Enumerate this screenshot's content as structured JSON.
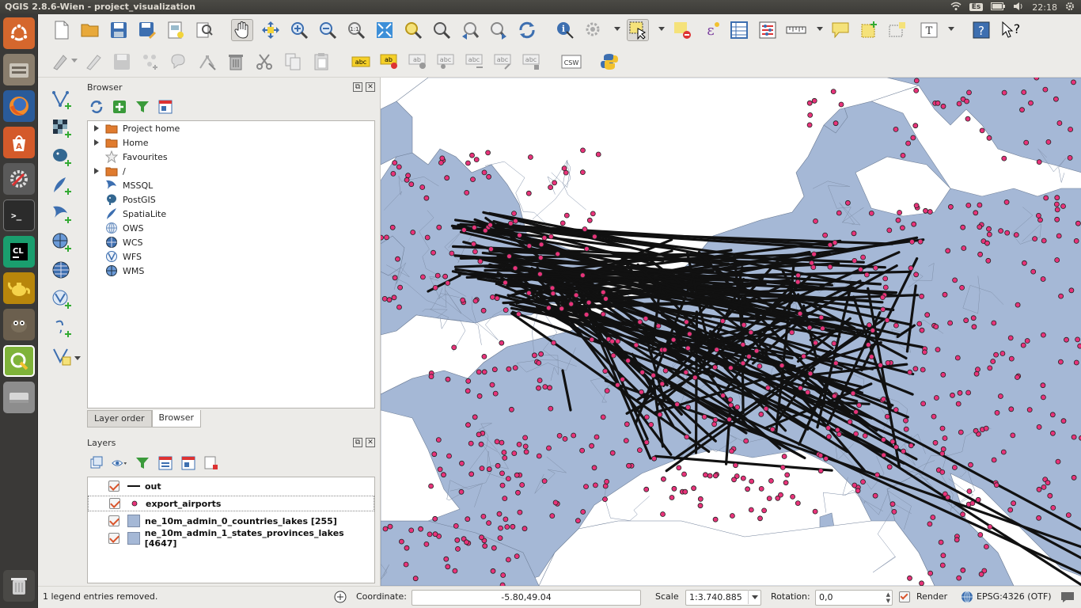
{
  "window": {
    "title": "QGIS 2.8.6-Wien - project_visualization",
    "keyboard_layout": "Es",
    "clock": "22:18"
  },
  "launcher": {
    "items": [
      "ubuntu-dash",
      "files",
      "firefox",
      "software-center",
      "system-settings",
      "terminal",
      "clion",
      "teapot",
      "gimp",
      "qgis",
      "disk"
    ],
    "trash": "trash"
  },
  "browser_panel": {
    "title": "Browser",
    "items": [
      {
        "label": "Project home",
        "icon": "folder-icon",
        "expandable": true
      },
      {
        "label": "Home",
        "icon": "folder-icon",
        "expandable": true
      },
      {
        "label": "Favourites",
        "icon": "star-icon",
        "expandable": false
      },
      {
        "label": "/",
        "icon": "folder-icon",
        "expandable": true
      },
      {
        "label": "MSSQL",
        "icon": "mssql-icon",
        "expandable": false
      },
      {
        "label": "PostGIS",
        "icon": "postgis-icon",
        "expandable": false
      },
      {
        "label": "SpatiaLite",
        "icon": "spatialite-icon",
        "expandable": false
      },
      {
        "label": "OWS",
        "icon": "globe-icon",
        "expandable": false
      },
      {
        "label": "WCS",
        "icon": "globe-icon",
        "expandable": false
      },
      {
        "label": "WFS",
        "icon": "globe-icon",
        "expandable": false
      },
      {
        "label": "WMS",
        "icon": "globe-icon",
        "expandable": false
      }
    ],
    "tabs": [
      {
        "label": "Layer order",
        "selected": false
      },
      {
        "label": "Browser",
        "selected": true
      }
    ]
  },
  "layers_panel": {
    "title": "Layers",
    "layers": [
      {
        "name": "out",
        "checked": true,
        "symbol": "line"
      },
      {
        "name": "export_airports",
        "checked": true,
        "symbol": "point"
      },
      {
        "name": "ne_10m_admin_0_countries_lakes [255]",
        "checked": true,
        "symbol": "polygon"
      },
      {
        "name": "ne_10m_admin_1_states_provinces_lakes [4647]",
        "checked": true,
        "symbol": "polygon"
      }
    ]
  },
  "statusbar": {
    "message": "1 legend entries removed.",
    "coordinate_label": "Coordinate:",
    "coordinate_value": "-5.80,49.04",
    "scale_label": "Scale",
    "scale_value": "1:3.740.885",
    "rotation_label": "Rotation:",
    "rotation_value": "0,0",
    "render_label": "Render",
    "crs": "EPSG:4326 (OTF)"
  },
  "colors": {
    "land": "#a5b8d6",
    "airport": "#e8337a",
    "route": "#111111",
    "render_check": "#d9542b"
  }
}
